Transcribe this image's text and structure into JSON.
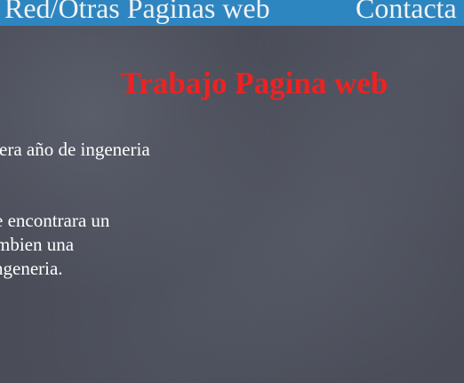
{
  "nav": {
    "items": [
      "Red/Otras Paginas web",
      "Contacta"
    ]
  },
  "title": "Trabajo Pagina web",
  "paragraphs": [
    [
      "era año de ingeneria"
    ],
    [
      "e encontrara un",
      "mbien una",
      "ngeneria."
    ]
  ]
}
